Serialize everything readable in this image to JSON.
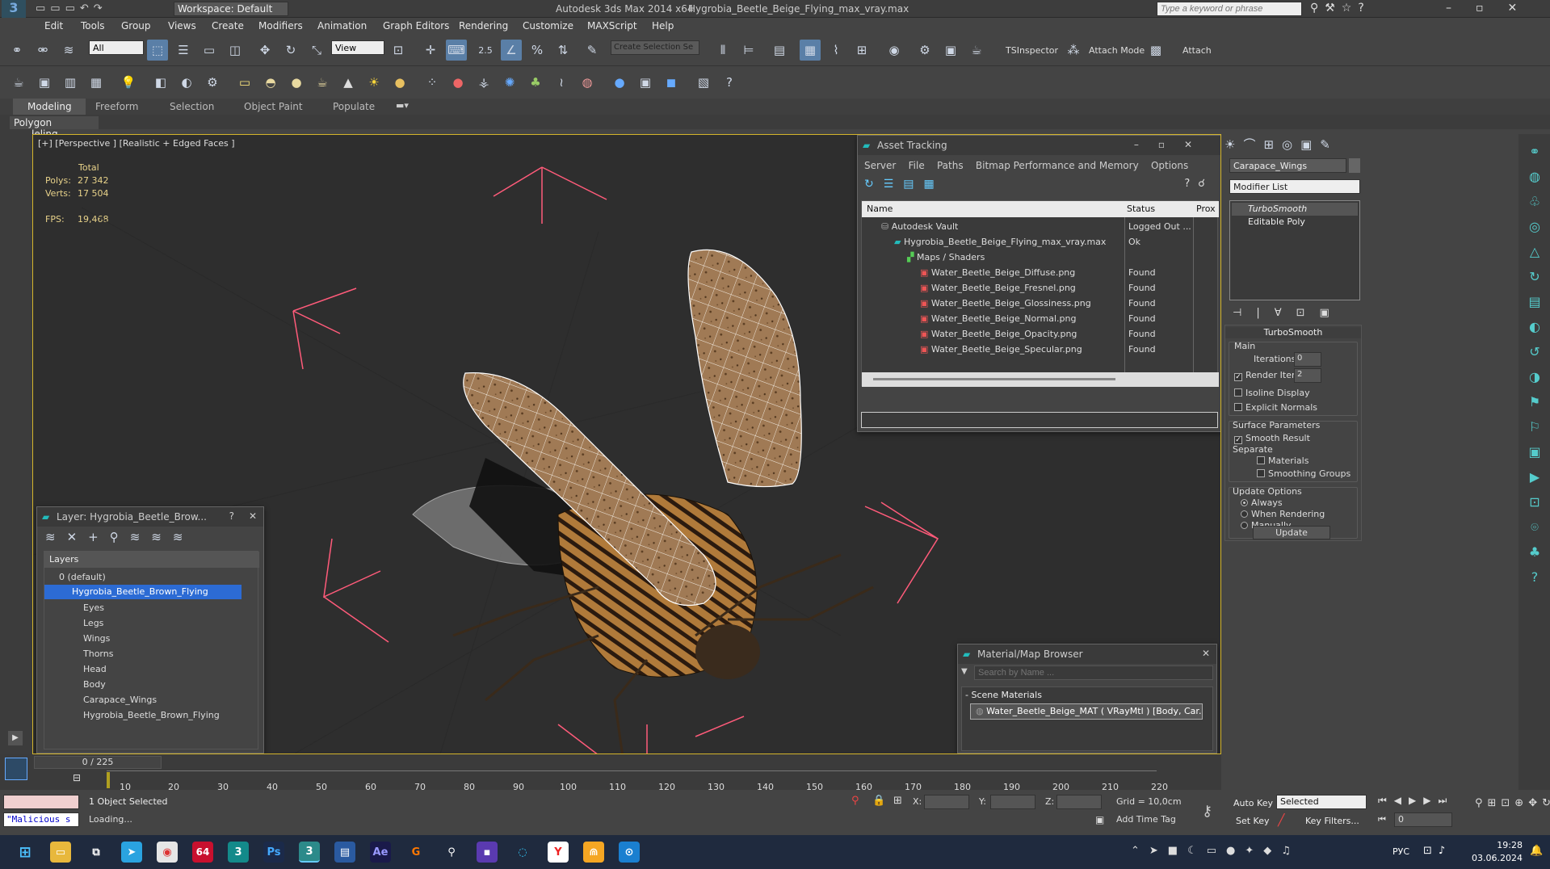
{
  "title": {
    "workspace": "Workspace: Default",
    "app": "Autodesk 3ds Max  2014 x64",
    "file": "Hygrobia_Beetle_Beige_Flying_max_vray.max",
    "search_placeholder": "Type a keyword or phrase"
  },
  "menu": [
    "Edit",
    "Tools",
    "Group",
    "Views",
    "Create",
    "Modifiers",
    "Animation",
    "Graph Editors",
    "Rendering",
    "Customize",
    "MAXScript",
    "Help"
  ],
  "toolbar": {
    "filter": "All",
    "view": "View",
    "selection_set": "Create Selection Se",
    "ts_inspector": "TSInspector",
    "attach_mode": "Attach Mode",
    "attach": "Attach",
    "snap_value": "2.5"
  },
  "ribbon": {
    "tabs": [
      "Modeling",
      "Freeform",
      "Selection",
      "Object Paint",
      "Populate"
    ],
    "panel": "Polygon Modeling"
  },
  "viewport": {
    "label": "[+] [Perspective ] [Realistic + Edged Faces ]",
    "total": "Total",
    "polys_label": "Polys:",
    "polys": "27 342",
    "verts_label": "Verts:",
    "verts": "17 504",
    "fps_label": "FPS:",
    "fps": "19,468"
  },
  "asset_tracking": {
    "title": "Asset Tracking",
    "menu": [
      "Server",
      "File",
      "Paths",
      "Bitmap Performance and Memory",
      "Options"
    ],
    "col_name": "Name",
    "col_status": "Status",
    "col_proxy": "Prox",
    "rows": [
      {
        "name": "Autodesk Vault",
        "status": "Logged Out ..."
      },
      {
        "name": "Hygrobia_Beetle_Beige_Flying_max_vray.max",
        "status": "Ok"
      },
      {
        "name": "Maps / Shaders",
        "status": ""
      },
      {
        "name": "Water_Beetle_Beige_Diffuse.png",
        "status": "Found"
      },
      {
        "name": "Water_Beetle_Beige_Fresnel.png",
        "status": "Found"
      },
      {
        "name": "Water_Beetle_Beige_Glossiness.png",
        "status": "Found"
      },
      {
        "name": "Water_Beetle_Beige_Normal.png",
        "status": "Found"
      },
      {
        "name": "Water_Beetle_Beige_Opacity.png",
        "status": "Found"
      },
      {
        "name": "Water_Beetle_Beige_Specular.png",
        "status": "Found"
      }
    ]
  },
  "layers": {
    "title": "Layer: Hygrobia_Beetle_Brow...",
    "header": "Layers",
    "items": [
      "0 (default)",
      "Hygrobia_Beetle_Brown_Flying",
      "Eyes",
      "Legs",
      "Wings",
      "Thorns",
      "Head",
      "Body",
      "Carapace_Wings",
      "Hygrobia_Beetle_Brown_Flying"
    ]
  },
  "material_browser": {
    "title": "Material/Map Browser",
    "search_placeholder": "Search by Name ...",
    "group": "Scene Materials",
    "item": "Water_Beetle_Beige_MAT ( VRayMtl ) [Body, Car..."
  },
  "command_panel": {
    "object_name": "Carapace_Wings",
    "modifier_list": "Modifier List",
    "stack": [
      "TurboSmooth",
      "Editable Poly"
    ],
    "rollout": "TurboSmooth",
    "main": "Main",
    "iterations_label": "Iterations:",
    "iterations": "0",
    "render_iters_label": "Render Iters:",
    "render_iters": "2",
    "isoline": "Isoline Display",
    "explicit": "Explicit Normals",
    "surface": "Surface Parameters",
    "smooth_result": "Smooth Result",
    "separate": "Separate",
    "materials": "Materials",
    "smoothing_groups": "Smoothing Groups",
    "update_options": "Update Options",
    "always": "Always",
    "when_rendering": "When Rendering",
    "manually": "Manually",
    "update": "Update"
  },
  "timeline": {
    "frame": "0 / 225",
    "ticks": [
      "10",
      "20",
      "30",
      "40",
      "50",
      "60",
      "70",
      "80",
      "90",
      "100",
      "110",
      "120",
      "130",
      "140",
      "150",
      "160",
      "170",
      "180",
      "190",
      "200",
      "210",
      "220"
    ]
  },
  "status": {
    "selected": "1 Object Selected",
    "loading": "Loading...",
    "maxscript": "\"Malicious s",
    "x": "X:",
    "y": "Y:",
    "z": "Z:",
    "grid": "Grid = 10,0cm",
    "add_time_tag": "Add Time Tag",
    "auto_key": "Auto Key",
    "set_key": "Set Key",
    "key_mode": "Selected",
    "key_filters": "Key Filters...",
    "frame_field": "0"
  },
  "taskbar": {
    "lang": "РУС",
    "time": "19:28",
    "date": "03.06.2024",
    "badge": "64"
  }
}
